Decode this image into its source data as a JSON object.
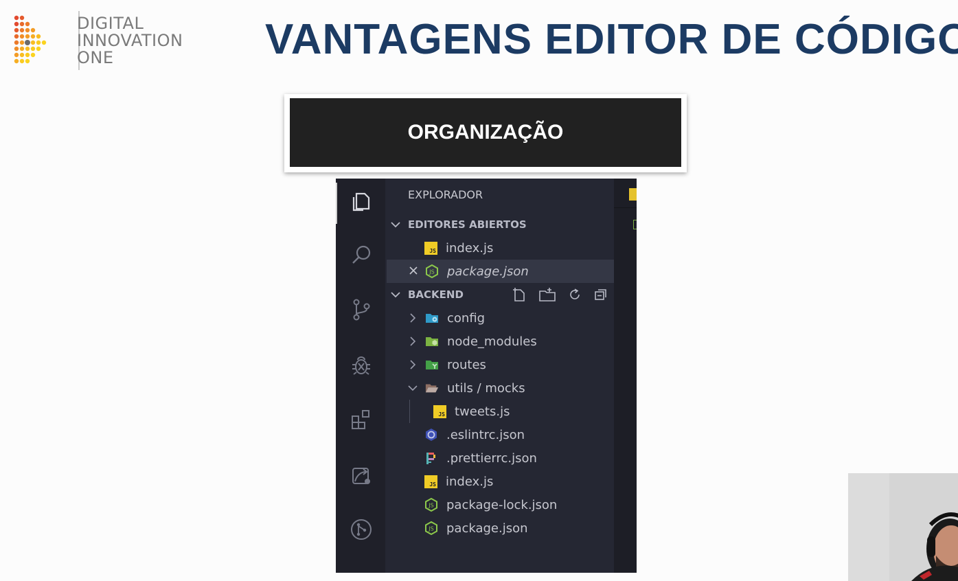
{
  "logo": {
    "line1": "DIGITAL",
    "line2": "INNOVATION",
    "line3": "ONE",
    "icon": "dio-logo-icon"
  },
  "slide": {
    "title": "VANTAGENS EDITOR DE CÓDIGO",
    "banner": "ORGANIZAÇÃO"
  },
  "explorer": {
    "title": "EXPLORADOR",
    "open_editors": {
      "label": "EDITORES ABIERTOS",
      "items": [
        {
          "name": "index.js",
          "icon": "js-file-icon"
        },
        {
          "name": "package.json",
          "icon": "node-file-icon",
          "close_icon": "close-icon"
        }
      ]
    },
    "project": {
      "label": "BACKEND",
      "actions": [
        "new-file-icon",
        "new-folder-icon",
        "refresh-icon",
        "collapse-all-icon"
      ],
      "items": [
        {
          "name": "config",
          "icon": "config-folder-icon"
        },
        {
          "name": "node_modules",
          "icon": "node-folder-icon"
        },
        {
          "name": "routes",
          "icon": "routes-folder-icon"
        },
        {
          "name": "utils / mocks",
          "icon": "open-folder-icon"
        },
        {
          "name": "tweets.js",
          "icon": "js-file-icon"
        },
        {
          "name": ".eslintrc.json",
          "icon": "eslint-icon"
        },
        {
          "name": ".prettierrc.json",
          "icon": "prettier-icon"
        },
        {
          "name": "index.js",
          "icon": "js-file-icon"
        },
        {
          "name": "package-lock.json",
          "icon": "node-file-icon"
        },
        {
          "name": "package.json",
          "icon": "node-file-icon"
        }
      ]
    }
  },
  "activity_bar": [
    "files-icon",
    "search-icon",
    "source-control-icon",
    "debug-icon",
    "extensions-icon",
    "remote-explorer-icon",
    "git-graph-icon"
  ],
  "colors": {
    "title": "#1c3b63",
    "banner_bg": "#212121",
    "sidebar_bg": "#252733",
    "activity_bg": "#1f2029",
    "js_yellow": "#f0cc26",
    "node_green": "#8cc84b"
  }
}
